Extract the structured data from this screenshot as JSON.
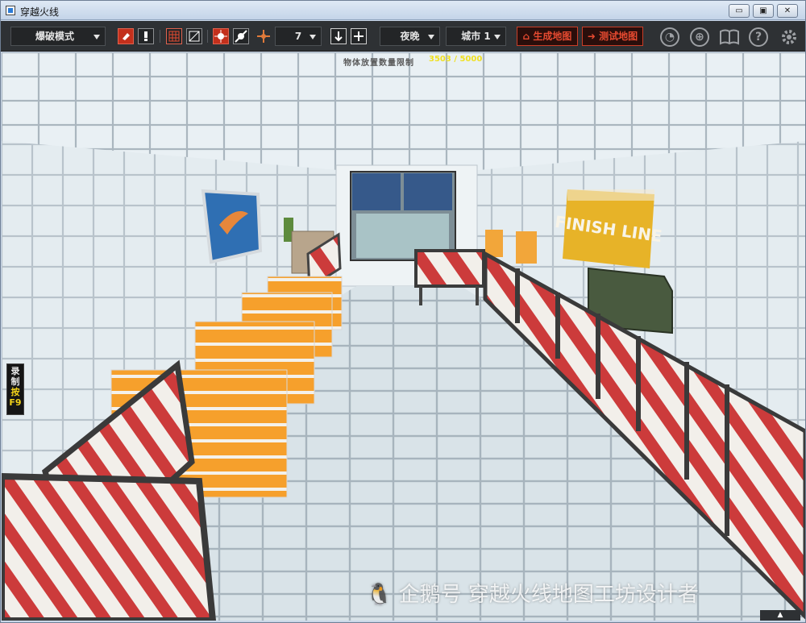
{
  "window": {
    "title": "穿越火线",
    "controls": {
      "minimize": "▭",
      "maximize": "▣",
      "close": "✕"
    }
  },
  "toolbar": {
    "mode_select": "爆破模式",
    "brush_size": "7",
    "time_select": "夜晚",
    "theme_select": "城市 1",
    "generate_map": "生成地图",
    "test_map": "测试地图",
    "icons": [
      "pencil-eraser",
      "hand-tool",
      "grid-icon",
      "slash-box-icon",
      "burst-icon",
      "burst-off-icon",
      "move-arrows-icon",
      "arrow-down-box-icon",
      "plus-box-icon",
      "undo-clock-icon",
      "add-clock-icon",
      "book-icon",
      "help-icon",
      "gear-icon"
    ],
    "colors": {
      "bar": "#2e3134",
      "accent_red": "#e64a30"
    }
  },
  "hud": {
    "limit_label": "物体放置数量限制",
    "count": "3503 / 5000"
  },
  "scene": {
    "finish_sign": "FINISH LINE"
  },
  "record_tab": {
    "label": "录制",
    "key": "按F9"
  },
  "watermark": "企鹅号 穿越火线地图工坊设计者"
}
